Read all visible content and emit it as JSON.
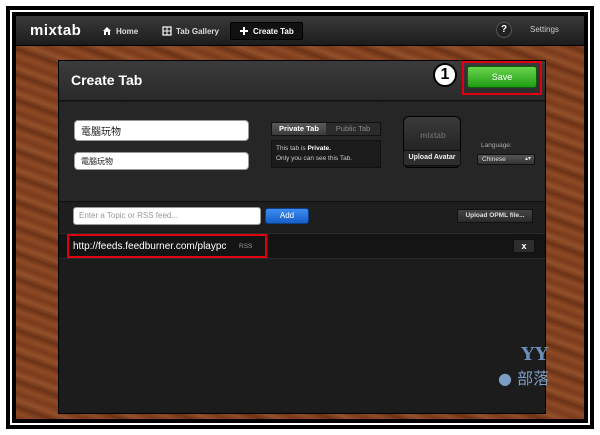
{
  "nav": {
    "logo": "mixtab",
    "items": [
      {
        "label": "Home",
        "icon": "home-icon"
      },
      {
        "label": "Tab Gallery",
        "icon": "grid-icon"
      },
      {
        "label": "Create Tab",
        "icon": "plus-icon"
      }
    ],
    "help_label": "?",
    "settings_label": "Settings"
  },
  "panel": {
    "title": "Create Tab",
    "step_number": "1",
    "save_label": "Save"
  },
  "form": {
    "tab_name_value": "電腦玩物",
    "description_value": "電腦玩物",
    "privacy": {
      "private_label": "Private Tab",
      "public_label": "Public Tab",
      "selected": "Private Tab",
      "line1_prefix": "This tab is ",
      "line1_strong": "Private.",
      "line2": "Only you can see this Tab."
    },
    "avatar": {
      "logo_text": "mixtab",
      "upload_label": "Upload Avatar"
    },
    "language": {
      "label": "Language:",
      "selected": "Chinese"
    }
  },
  "topic": {
    "placeholder": "Enter a Topic or RSS feed...",
    "add_label": "Add",
    "opml_label": "Upload OPML file..."
  },
  "feeds": [
    {
      "url": "http://feeds.feedburner.com/playpc",
      "tag": "RSS",
      "remove_label": "x"
    }
  ],
  "watermark": {
    "top": "YY",
    "bottom": "部落"
  },
  "colors": {
    "highlight": "#e00012",
    "save_green": "#2fa51f",
    "add_blue": "#2a78e4"
  }
}
